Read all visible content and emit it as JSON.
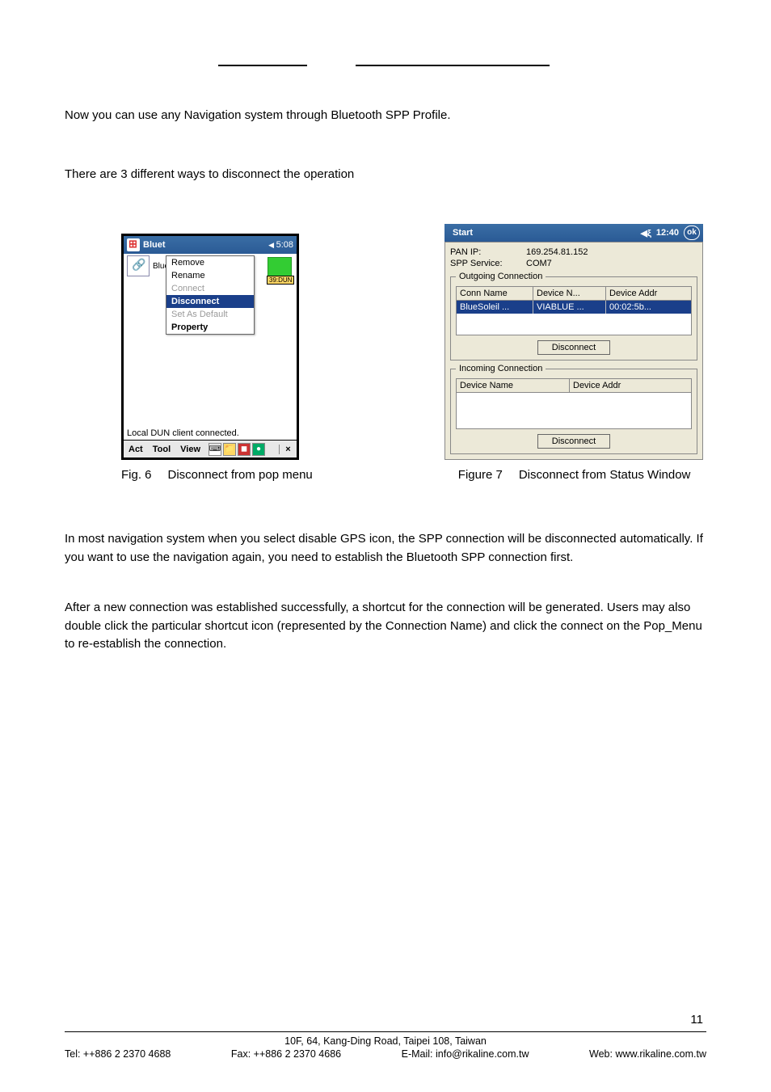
{
  "top_text_1": "Now you can use any Navigation system through Bluetooth SPP Profile.",
  "top_text_2": "There are 3 different ways to disconnect the operation",
  "fig6": {
    "title_app": "Bluet",
    "time": "5:08",
    "bt_label": "BlueSoleil",
    "green_label": "39:DUN",
    "menu": {
      "remove": "Remove",
      "rename": "Rename",
      "connect": "Connect",
      "disconnect": "Disconnect",
      "set_default": "Set As Default",
      "property": "Property"
    },
    "status_line": "Local DUN client connected.",
    "menus": {
      "act": "Act",
      "tool": "Tool",
      "view": "View"
    }
  },
  "fig7": {
    "title": "Start",
    "time": "12:40",
    "ok": "ok",
    "pan_ip_label": "PAN IP:",
    "pan_ip": "169.254.81.152",
    "spp_label": "SPP Service:",
    "spp": "COM7",
    "outgoing_legend": "Outgoing Connection",
    "out_headers": {
      "c1": "Conn Name",
      "c2": "Device N...",
      "c3": "Device Addr"
    },
    "out_row": {
      "c1": "BlueSoleil ...",
      "c2": "VIABLUE ...",
      "c3": "00:02:5b..."
    },
    "disconnect_btn": "Disconnect",
    "incoming_legend": "Incoming Connection",
    "in_headers": {
      "c1": "Device Name",
      "c2": "Device Addr"
    }
  },
  "captions": {
    "fig6_no": "Fig. 6",
    "fig6_text": "Disconnect from pop menu",
    "fig7_no": "Figure 7",
    "fig7_text": "Disconnect from Status Window"
  },
  "para3": "In most navigation system when you select disable GPS icon, the SPP connection will be disconnected automatically. If you want to use the navigation again, you need to establish the Bluetooth SPP connection first.",
  "para4": "After a new connection was established successfully, a shortcut for the connection will be generated. Users may also double click the particular shortcut icon (represented by the Connection Name) and click the connect on the Pop_Menu to re-establish the connection.",
  "footer": {
    "page": "11",
    "address": "10F, 64, Kang-Ding Road, Taipei 108, Taiwan",
    "tel": "Tel: ++886 2 2370 4688",
    "fax": "Fax: ++886 2 2370 4686",
    "email": "E-Mail: info@rikaline.com.tw",
    "web": "Web: www.rikaline.com.tw"
  }
}
